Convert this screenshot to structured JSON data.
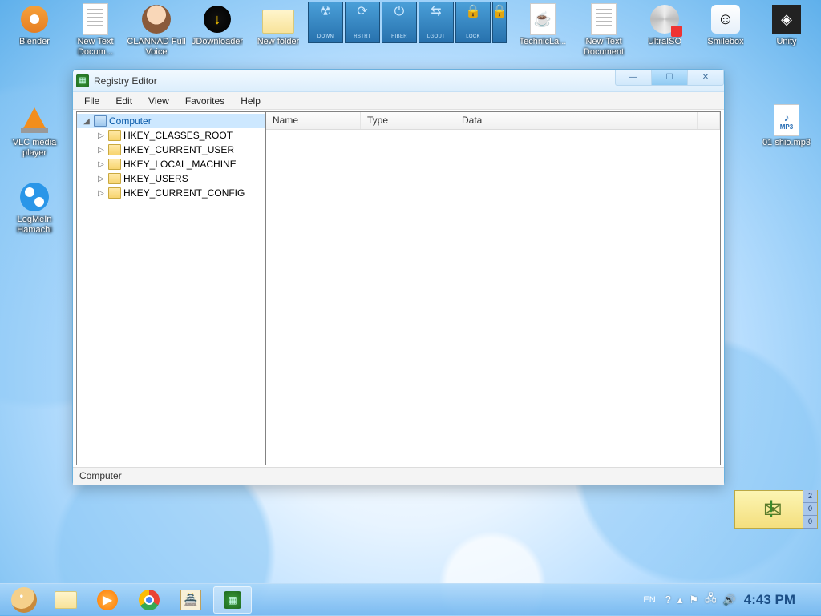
{
  "desktop": {
    "icons": [
      {
        "label": "Blender"
      },
      {
        "label": "New Text Docum..."
      },
      {
        "label": "CLANNAD Full Voice"
      },
      {
        "label": "JDownloader"
      },
      {
        "label": "New folder"
      },
      {
        "label": "TechnicLa..."
      },
      {
        "label": "New Text Document"
      },
      {
        "label": "UltraISO"
      },
      {
        "label": "Smilebox"
      },
      {
        "label": "Unity"
      },
      {
        "label": "VLC media player"
      },
      {
        "label": "01 shio.mp3"
      },
      {
        "label": "LogMeIn Hamachi"
      }
    ],
    "mp3_badge": "MP3"
  },
  "gadget": {
    "buttons": [
      {
        "label": "DOWN",
        "glyph": "☢"
      },
      {
        "label": "RSTRT",
        "glyph": "⟳"
      },
      {
        "label": "HIBER",
        "glyph": "⏻"
      },
      {
        "label": "LGOUT",
        "glyph": "⇆"
      },
      {
        "label": "LOCK",
        "glyph": "🔒"
      }
    ]
  },
  "mail": {
    "counts": [
      "2",
      "0",
      "0"
    ]
  },
  "window": {
    "title": "Registry Editor",
    "menus": [
      "File",
      "Edit",
      "View",
      "Favorites",
      "Help"
    ],
    "tree": {
      "root": "Computer",
      "keys": [
        "HKEY_CLASSES_ROOT",
        "HKEY_CURRENT_USER",
        "HKEY_LOCAL_MACHINE",
        "HKEY_USERS",
        "HKEY_CURRENT_CONFIG"
      ]
    },
    "columns": [
      "Name",
      "Type",
      "Data"
    ],
    "status": "Computer"
  },
  "taskbar": {
    "lang": "EN",
    "clock": "4:43 PM"
  }
}
